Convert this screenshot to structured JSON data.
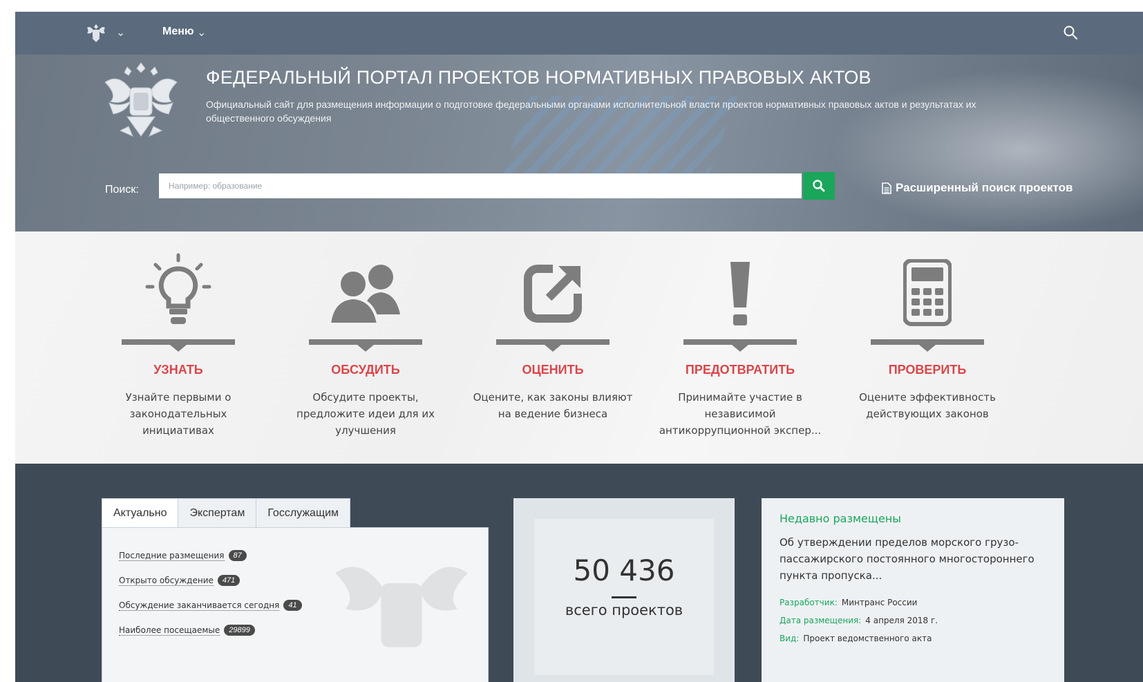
{
  "topbar": {
    "menu_label": "Меню"
  },
  "hero": {
    "title": "ФЕДЕРАЛЬНЫЙ ПОРТАЛ ПРОЕКТОВ НОРМАТИВНЫХ ПРАВОВЫХ АКТОВ",
    "subtitle": "Официальный сайт для размещения информации о подготовке федеральными органами исполнительной власти проектов нормативных правовых актов и результатах их общественного обсуждения",
    "search_label": "Поиск:",
    "search_placeholder": "Например: образование",
    "advanced_search": "Расширенный поиск проектов"
  },
  "features": [
    {
      "title": "УЗНАТЬ",
      "desc": "Узнайте первыми о законодательных инициативах",
      "icon": "lightbulb-icon"
    },
    {
      "title": "ОБСУДИТЬ",
      "desc": "Обсудите проекты, предложите идеи для их улучшения",
      "icon": "people-icon"
    },
    {
      "title": "ОЦЕНИТЬ",
      "desc": "Оцените, как законы влияют на ведение бизнеса",
      "icon": "share-arrow-icon"
    },
    {
      "title": "ПРЕДОТВРАТИТЬ",
      "desc": "Принимайте участие в независимой антикоррупционной экспер...",
      "icon": "exclamation-icon"
    },
    {
      "title": "ПРОВЕРИТЬ",
      "desc": "Оцените эффективность действующих законов",
      "icon": "calculator-icon"
    }
  ],
  "tabs": {
    "items": [
      "Актуально",
      "Экспертам",
      "Госслужащим"
    ],
    "active": "Актуально",
    "links": [
      {
        "label": "Последние размещения",
        "count": "87"
      },
      {
        "label": "Открыто обсуждение",
        "count": "471"
      },
      {
        "label": "Обсуждение заканчивается сегодня",
        "count": "41"
      },
      {
        "label": "Наиболее посещаемые",
        "count": "29899"
      }
    ]
  },
  "counter": {
    "number": "50 436",
    "label": "всего проектов"
  },
  "recent": {
    "heading": "Недавно размещены",
    "title": "Об утверждении пределов морского грузо-пассажирского постоянного многостороннего пункта пропуска...",
    "developer_key": "Разработчик:",
    "developer_value": "Минтранс России",
    "date_key": "Дата размещения:",
    "date_value": "4 апреля 2018 г.",
    "type_key": "Вид:",
    "type_value": "Проект ведомственного акта"
  },
  "colors": {
    "topbar": "#5b6a7c",
    "accent_red": "#d9464a",
    "accent_green": "#1aa65b",
    "dark_bottom": "#3f4a57"
  }
}
